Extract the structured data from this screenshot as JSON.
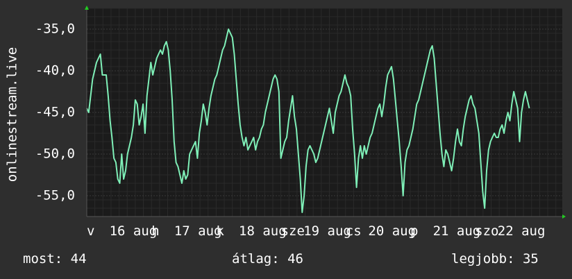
{
  "chart_data": {
    "type": "line",
    "ylabel": "onlinestream.live",
    "title": "",
    "ylim": [
      -57.5,
      -32.5
    ],
    "yticks": [
      -55,
      -50,
      -45,
      -40,
      -35
    ],
    "ytick_labels": [
      "-55,0",
      "-50,0",
      "-45,0",
      "-40,0",
      "-35,0"
    ],
    "xlim": [
      0,
      7.35
    ],
    "xticks": [
      {
        "x": 0.0,
        "label": "v"
      },
      {
        "x": 0.35,
        "label": "16 aug"
      },
      {
        "x": 1.0,
        "label": "h"
      },
      {
        "x": 1.35,
        "label": "17 aug"
      },
      {
        "x": 2.0,
        "label": "k"
      },
      {
        "x": 2.35,
        "label": "18 aug"
      },
      {
        "x": 3.0,
        "label": "sze"
      },
      {
        "x": 3.35,
        "label": "19 aug"
      },
      {
        "x": 4.0,
        "label": "cs"
      },
      {
        "x": 4.35,
        "label": "20 aug"
      },
      {
        "x": 5.0,
        "label": "p"
      },
      {
        "x": 5.35,
        "label": "21 aug"
      },
      {
        "x": 6.0,
        "label": "szo"
      },
      {
        "x": 6.35,
        "label": "22 aug"
      }
    ],
    "grid": true,
    "series": [
      {
        "color": "#7ff0b8",
        "points": [
          [
            0.0,
            -44.5
          ],
          [
            0.03,
            -45.0
          ],
          [
            0.06,
            -43.0
          ],
          [
            0.09,
            -41.0
          ],
          [
            0.12,
            -40.0
          ],
          [
            0.15,
            -39.0
          ],
          [
            0.18,
            -38.5
          ],
          [
            0.21,
            -38.0
          ],
          [
            0.24,
            -40.5
          ],
          [
            0.27,
            -40.5
          ],
          [
            0.3,
            -40.5
          ],
          [
            0.33,
            -43.0
          ],
          [
            0.36,
            -46.0
          ],
          [
            0.39,
            -48.0
          ],
          [
            0.42,
            -50.5
          ],
          [
            0.45,
            -51.0
          ],
          [
            0.48,
            -53.0
          ],
          [
            0.51,
            -53.5
          ],
          [
            0.54,
            -50.0
          ],
          [
            0.57,
            -53.0
          ],
          [
            0.6,
            -52.0
          ],
          [
            0.63,
            -50.0
          ],
          [
            0.66,
            -49.0
          ],
          [
            0.69,
            -48.0
          ],
          [
            0.72,
            -46.5
          ],
          [
            0.75,
            -43.5
          ],
          [
            0.78,
            -44.0
          ],
          [
            0.81,
            -46.5
          ],
          [
            0.84,
            -45.5
          ],
          [
            0.87,
            -44.0
          ],
          [
            0.9,
            -47.5
          ],
          [
            0.93,
            -43.0
          ],
          [
            0.96,
            -41.0
          ],
          [
            0.99,
            -39.0
          ],
          [
            1.02,
            -40.5
          ],
          [
            1.05,
            -39.5
          ],
          [
            1.08,
            -38.5
          ],
          [
            1.11,
            -38.0
          ],
          [
            1.14,
            -37.5
          ],
          [
            1.17,
            -38.0
          ],
          [
            1.2,
            -37.0
          ],
          [
            1.23,
            -36.5
          ],
          [
            1.26,
            -37.5
          ],
          [
            1.29,
            -40.0
          ],
          [
            1.32,
            -43.5
          ],
          [
            1.35,
            -48.5
          ],
          [
            1.38,
            -51.0
          ],
          [
            1.41,
            -51.5
          ],
          [
            1.44,
            -52.5
          ],
          [
            1.47,
            -53.5
          ],
          [
            1.5,
            -52.0
          ],
          [
            1.53,
            -53.0
          ],
          [
            1.56,
            -52.5
          ],
          [
            1.59,
            -50.0
          ],
          [
            1.62,
            -49.5
          ],
          [
            1.65,
            -49.0
          ],
          [
            1.68,
            -48.5
          ],
          [
            1.71,
            -50.5
          ],
          [
            1.74,
            -47.5
          ],
          [
            1.77,
            -46.0
          ],
          [
            1.8,
            -44.0
          ],
          [
            1.83,
            -45.0
          ],
          [
            1.86,
            -46.5
          ],
          [
            1.89,
            -44.5
          ],
          [
            1.92,
            -43.0
          ],
          [
            1.95,
            -42.0
          ],
          [
            1.98,
            -41.0
          ],
          [
            2.01,
            -40.5
          ],
          [
            2.04,
            -39.5
          ],
          [
            2.07,
            -38.5
          ],
          [
            2.1,
            -37.5
          ],
          [
            2.13,
            -37.0
          ],
          [
            2.16,
            -36.0
          ],
          [
            2.19,
            -35.0
          ],
          [
            2.22,
            -35.5
          ],
          [
            2.25,
            -36.0
          ],
          [
            2.28,
            -38.0
          ],
          [
            2.31,
            -41.0
          ],
          [
            2.34,
            -44.0
          ],
          [
            2.37,
            -46.5
          ],
          [
            2.4,
            -48.0
          ],
          [
            2.43,
            -49.0
          ],
          [
            2.46,
            -48.0
          ],
          [
            2.49,
            -49.5
          ],
          [
            2.52,
            -49.0
          ],
          [
            2.55,
            -48.5
          ],
          [
            2.58,
            -48.0
          ],
          [
            2.61,
            -49.5
          ],
          [
            2.64,
            -48.5
          ],
          [
            2.67,
            -48.0
          ],
          [
            2.7,
            -47.0
          ],
          [
            2.73,
            -46.5
          ],
          [
            2.76,
            -45.0
          ],
          [
            2.79,
            -44.0
          ],
          [
            2.82,
            -43.0
          ],
          [
            2.85,
            -42.0
          ],
          [
            2.88,
            -41.0
          ],
          [
            2.91,
            -40.5
          ],
          [
            2.94,
            -41.0
          ],
          [
            2.97,
            -42.5
          ],
          [
            3.0,
            -50.5
          ],
          [
            3.03,
            -49.5
          ],
          [
            3.06,
            -48.5
          ],
          [
            3.09,
            -48.0
          ],
          [
            3.12,
            -46.0
          ],
          [
            3.15,
            -44.5
          ],
          [
            3.18,
            -43.0
          ],
          [
            3.21,
            -45.5
          ],
          [
            3.24,
            -47.0
          ],
          [
            3.27,
            -50.0
          ],
          [
            3.3,
            -53.0
          ],
          [
            3.33,
            -57.0
          ],
          [
            3.36,
            -55.0
          ],
          [
            3.39,
            -51.5
          ],
          [
            3.42,
            -49.5
          ],
          [
            3.45,
            -49.0
          ],
          [
            3.48,
            -49.5
          ],
          [
            3.51,
            -50.0
          ],
          [
            3.54,
            -51.0
          ],
          [
            3.57,
            -50.5
          ],
          [
            3.6,
            -49.5
          ],
          [
            3.63,
            -48.5
          ],
          [
            3.66,
            -47.5
          ],
          [
            3.69,
            -46.5
          ],
          [
            3.72,
            -45.5
          ],
          [
            3.75,
            -44.5
          ],
          [
            3.78,
            -46.0
          ],
          [
            3.81,
            -47.5
          ],
          [
            3.84,
            -45.0
          ],
          [
            3.87,
            -44.0
          ],
          [
            3.9,
            -43.0
          ],
          [
            3.93,
            -42.5
          ],
          [
            3.96,
            -41.5
          ],
          [
            3.99,
            -40.5
          ],
          [
            4.02,
            -41.5
          ],
          [
            4.05,
            -42.0
          ],
          [
            4.08,
            -43.0
          ],
          [
            4.11,
            -47.0
          ],
          [
            4.14,
            -50.0
          ],
          [
            4.17,
            -54.0
          ],
          [
            4.2,
            -50.5
          ],
          [
            4.23,
            -49.0
          ],
          [
            4.26,
            -50.5
          ],
          [
            4.29,
            -49.0
          ],
          [
            4.32,
            -50.0
          ],
          [
            4.35,
            -49.0
          ],
          [
            4.38,
            -48.0
          ],
          [
            4.41,
            -47.5
          ],
          [
            4.44,
            -46.5
          ],
          [
            4.47,
            -45.5
          ],
          [
            4.5,
            -44.5
          ],
          [
            4.53,
            -44.0
          ],
          [
            4.56,
            -45.5
          ],
          [
            4.59,
            -44.0
          ],
          [
            4.62,
            -42.0
          ],
          [
            4.65,
            -40.5
          ],
          [
            4.68,
            -40.0
          ],
          [
            4.71,
            -39.5
          ],
          [
            4.74,
            -41.0
          ],
          [
            4.77,
            -43.5
          ],
          [
            4.8,
            -46.0
          ],
          [
            4.83,
            -48.5
          ],
          [
            4.86,
            -51.5
          ],
          [
            4.89,
            -55.0
          ],
          [
            4.92,
            -51.0
          ],
          [
            4.95,
            -49.5
          ],
          [
            4.98,
            -49.0
          ],
          [
            5.01,
            -48.0
          ],
          [
            5.04,
            -47.0
          ],
          [
            5.07,
            -45.5
          ],
          [
            5.1,
            -44.0
          ],
          [
            5.13,
            -43.5
          ],
          [
            5.16,
            -42.5
          ],
          [
            5.19,
            -41.5
          ],
          [
            5.22,
            -40.5
          ],
          [
            5.25,
            -39.5
          ],
          [
            5.28,
            -38.5
          ],
          [
            5.31,
            -37.5
          ],
          [
            5.34,
            -37.0
          ],
          [
            5.37,
            -38.5
          ],
          [
            5.4,
            -41.5
          ],
          [
            5.43,
            -44.5
          ],
          [
            5.46,
            -47.5
          ],
          [
            5.49,
            -50.0
          ],
          [
            5.52,
            -51.5
          ],
          [
            5.55,
            -49.5
          ],
          [
            5.58,
            -50.0
          ],
          [
            5.61,
            -51.0
          ],
          [
            5.64,
            -52.0
          ],
          [
            5.67,
            -50.5
          ],
          [
            5.7,
            -48.5
          ],
          [
            5.73,
            -47.0
          ],
          [
            5.76,
            -48.5
          ],
          [
            5.79,
            -49.0
          ],
          [
            5.82,
            -47.0
          ],
          [
            5.85,
            -45.5
          ],
          [
            5.88,
            -44.5
          ],
          [
            5.91,
            -43.5
          ],
          [
            5.94,
            -43.0
          ],
          [
            5.97,
            -44.0
          ],
          [
            6.0,
            -44.5
          ],
          [
            6.03,
            -46.0
          ],
          [
            6.06,
            -47.5
          ],
          [
            6.09,
            -51.0
          ],
          [
            6.12,
            -54.5
          ],
          [
            6.15,
            -56.5
          ],
          [
            6.18,
            -52.0
          ],
          [
            6.21,
            -49.5
          ],
          [
            6.24,
            -48.5
          ],
          [
            6.27,
            -48.0
          ],
          [
            6.3,
            -47.5
          ],
          [
            6.33,
            -48.0
          ],
          [
            6.36,
            -48.0
          ],
          [
            6.39,
            -47.0
          ],
          [
            6.42,
            -46.5
          ],
          [
            6.45,
            -47.5
          ],
          [
            6.48,
            -46.0
          ],
          [
            6.51,
            -45.0
          ],
          [
            6.54,
            -46.0
          ],
          [
            6.57,
            -44.0
          ],
          [
            6.6,
            -42.5
          ],
          [
            6.63,
            -43.5
          ],
          [
            6.66,
            -44.5
          ],
          [
            6.69,
            -48.5
          ],
          [
            6.72,
            -45.0
          ],
          [
            6.75,
            -43.5
          ],
          [
            6.78,
            -42.5
          ],
          [
            6.81,
            -43.5
          ],
          [
            6.84,
            -44.5
          ]
        ]
      }
    ]
  },
  "stats": {
    "now": "most: 44",
    "avg": "átlag: 46",
    "max": "legjobb: 35"
  },
  "colors": {
    "background": "#2e2e2e",
    "plot_background": "#1b1b1b",
    "grid": "#3a3a3a",
    "grid_minor": "#2a2a2a",
    "line": "#7ff0b8",
    "axis_arrow": "#22cc22",
    "text": "#ffffff"
  }
}
